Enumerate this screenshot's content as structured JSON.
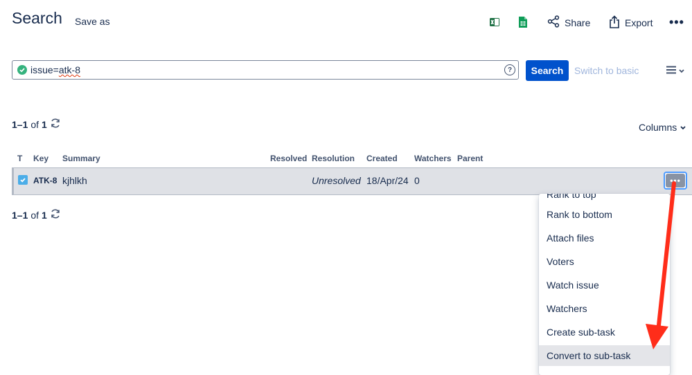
{
  "header": {
    "title": "Search",
    "save_as": "Save as",
    "share": "Share",
    "export": "Export",
    "excel_icon": "excel-icon",
    "sheets_icon": "google-sheets-icon"
  },
  "query": {
    "value": "issue=atk-8",
    "value_prefix": "issue=",
    "value_underlined": "atk-8",
    "search_button": "Search",
    "switch_to_basic": "Switch to basic"
  },
  "pagination": {
    "range": "1–1",
    "of": "of",
    "total": "1"
  },
  "columns_button": "Columns",
  "table": {
    "headers": [
      "T",
      "Key",
      "Summary",
      "Resolved",
      "Resolution",
      "Created",
      "Watchers",
      "Parent"
    ],
    "rows": [
      {
        "type_icon": "task-icon",
        "key": "ATK-8",
        "summary": "kjhlkh",
        "resolved": "",
        "resolution": "Unresolved",
        "created": "18/Apr/24",
        "watchers": "0",
        "parent": ""
      }
    ]
  },
  "row_menu": {
    "items": [
      "Rank to top",
      "Rank to bottom",
      "Attach files",
      "Voters",
      "Watch issue",
      "Watchers",
      "Create sub-task",
      "Convert to sub-task"
    ],
    "highlighted": "Convert to sub-task"
  },
  "colors": {
    "primary": "#0052cc",
    "text": "#172b4d",
    "row_selected": "#dfe1e6",
    "annotation_arrow": "#ff2d1a",
    "success": "#36b37e"
  }
}
